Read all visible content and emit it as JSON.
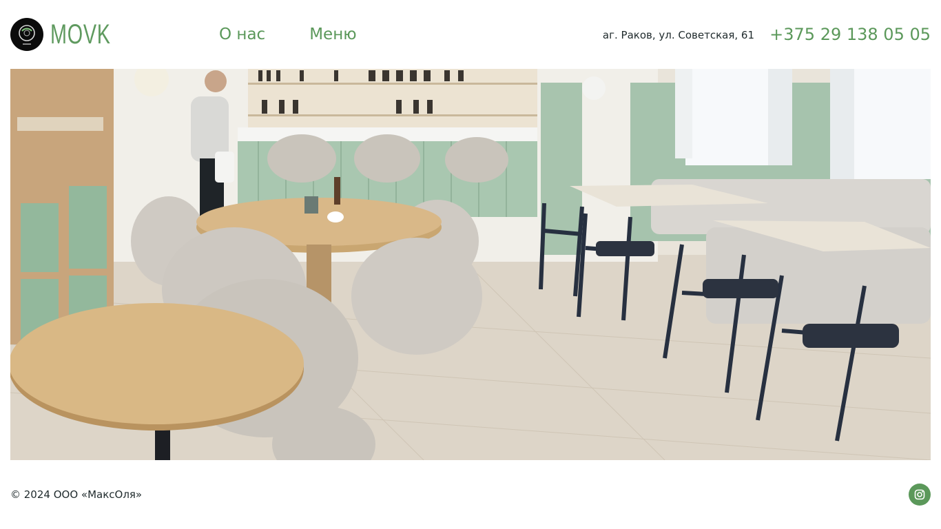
{
  "header": {
    "logo": {
      "brand": "MOVK",
      "mark_caption": "MOVK"
    },
    "nav": [
      {
        "label": "О нас"
      },
      {
        "label": "Меню"
      }
    ],
    "address": "аг. Раков, ул. Советская, 61",
    "phone": "+375 29 138 05 05"
  },
  "hero": {
    "alt": "interior photo"
  },
  "footer": {
    "copyright": "© 2024 ООО «МаксОля»",
    "social": {
      "icon": "instagram-icon"
    }
  },
  "colors": {
    "accent": "#5b985a",
    "text": "#1f2a2c",
    "background": "#ffffff"
  }
}
